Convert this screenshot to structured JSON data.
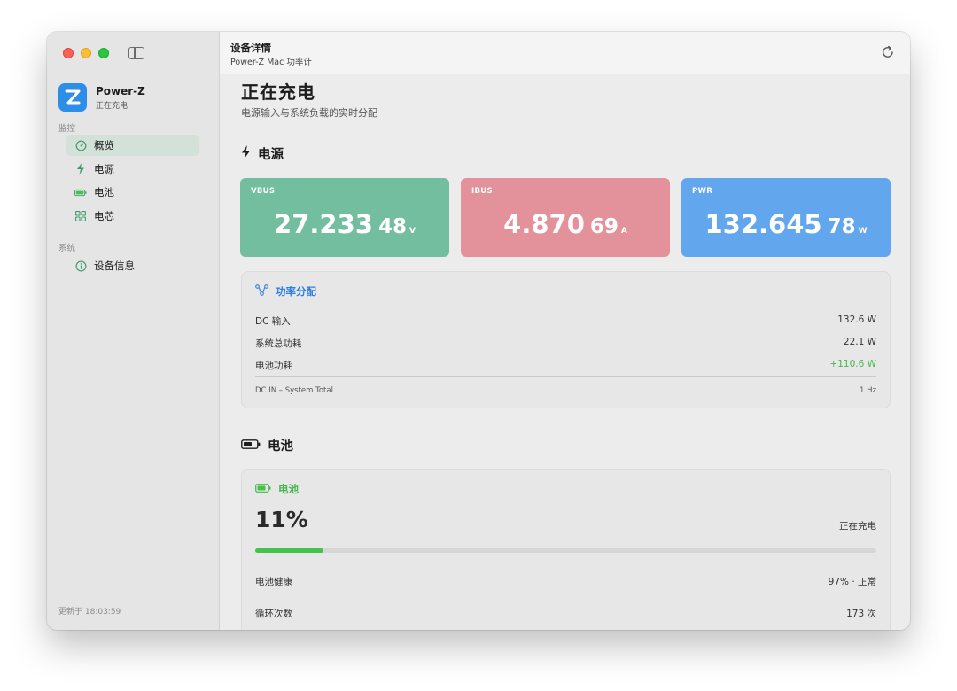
{
  "sidebar": {
    "app_name": "Power-Z",
    "app_status": "正在充电",
    "section_monitor": "监控",
    "section_system": "系统",
    "items": [
      {
        "label": "概览",
        "icon": "gauge-icon"
      },
      {
        "label": "电源",
        "icon": "bolt-icon"
      },
      {
        "label": "电池",
        "icon": "battery-icon"
      },
      {
        "label": "电芯",
        "icon": "grid-icon"
      }
    ],
    "system_items": [
      {
        "label": "设备信息",
        "icon": "info-icon"
      }
    ],
    "footer": "更新于 18:03:59"
  },
  "topbar": {
    "title": "设备详情",
    "subtitle": "Power-Z Mac 功率计"
  },
  "page": {
    "title": "正在充电",
    "subtitle": "电源输入与系统负载的实时分配"
  },
  "power_section": {
    "title": "电源",
    "metrics": [
      {
        "label": "VBUS",
        "big": "27.233",
        "small": "48",
        "unit": "V",
        "color": "#72be9f"
      },
      {
        "label": "IBUS",
        "big": "4.870",
        "small": "69",
        "unit": "A",
        "color": "#e3919b"
      },
      {
        "label": "PWR",
        "big": "132.645",
        "small": "78",
        "unit": "W",
        "color": "#62a7ee"
      }
    ]
  },
  "distribution": {
    "title": "功率分配",
    "rows": [
      {
        "label": "DC 输入",
        "value": "132.6 W"
      },
      {
        "label": "系统总功耗",
        "value": "22.1 W"
      },
      {
        "label": "电池功耗",
        "value": "+110.6 W"
      }
    ],
    "footer_left": "DC IN – System Total",
    "footer_right": "1 Hz",
    "positive_color": "#44b84c"
  },
  "battery_section": {
    "title": "电池",
    "card_title": "电池",
    "percent": "11%",
    "percent_value": 0.11,
    "status": "正在充电",
    "rows": [
      {
        "label": "电池健康",
        "value": "97% · 正常"
      },
      {
        "label": "循环次数",
        "value": "173 次"
      }
    ]
  }
}
